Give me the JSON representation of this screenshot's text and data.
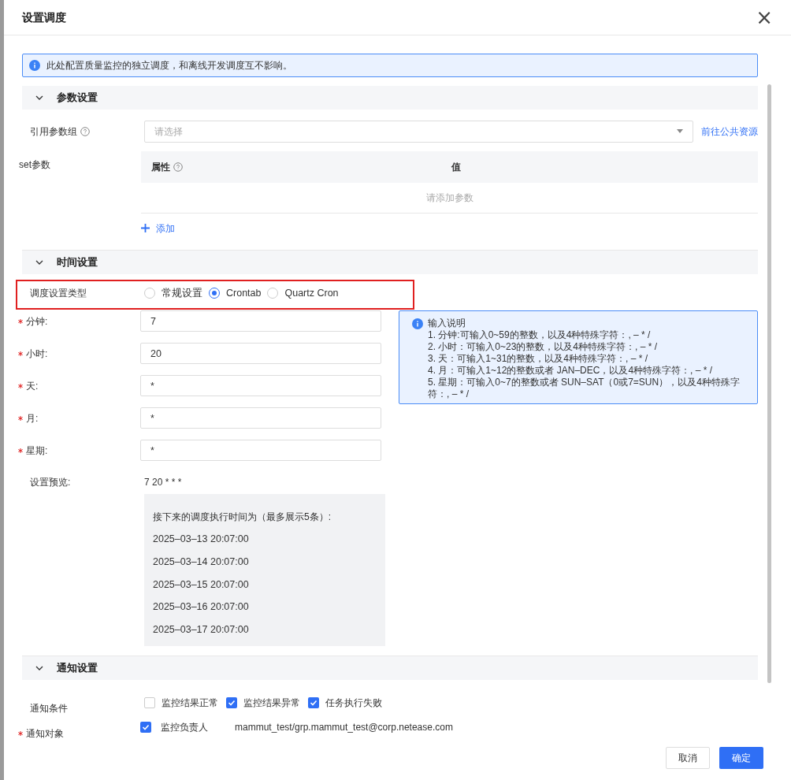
{
  "dialog": {
    "title": "设置调度",
    "close": "×"
  },
  "alert": {
    "text": "此处配置质量监控的独立调度，和离线开发调度互不影响。"
  },
  "param_section": {
    "title": "参数设置",
    "expanded": true,
    "param_group": {
      "label": "引用参数组",
      "placeholder": "请选择",
      "link": "前往公共资源"
    },
    "set_params": {
      "label": "set参数",
      "columns": [
        "属性",
        "值"
      ],
      "empty": "请添加参数",
      "add": "添加"
    }
  },
  "time_section": {
    "title": "时间设置",
    "expanded": true,
    "type_row": {
      "label": "调度设置类型",
      "highlighted": true,
      "options": [
        {
          "label": "常规设置",
          "selected": false
        },
        {
          "label": "Crontab",
          "selected": true
        },
        {
          "label": "Quartz Cron",
          "selected": false
        }
      ]
    },
    "fields": [
      {
        "label": "分钟:",
        "required": true,
        "value": "7"
      },
      {
        "label": "小时:",
        "required": true,
        "value": "20"
      },
      {
        "label": "天:",
        "required": true,
        "value": "*"
      },
      {
        "label": "月:",
        "required": true,
        "value": "*"
      },
      {
        "label": "星期:",
        "required": true,
        "value": "*"
      }
    ],
    "help": {
      "title": "输入说明",
      "lines": [
        "1. 分钟:可输入0~59的整数，以及4种特殊字符：, – * /",
        "2. 小时：可输入0~23的整数，以及4种特殊字符：, – * /",
        "3. 天：可输入1~31的整数，以及4种特殊字符：, – * /",
        "4. 月：可输入1~12的整数或者 JAN–DEC，以及4种特殊字符：, – * /",
        "5. 星期：可输入0~7的整数或者 SUN–SAT（0或7=SUN），以及4种特殊字符：, – * /"
      ]
    },
    "preview": {
      "label": "设置预览:",
      "expression": "7 20 * * *",
      "heading": "接下来的调度执行时间为（最多展示5条）:",
      "times": [
        "2025–03–13 20:07:00",
        "2025–03–14 20:07:00",
        "2025–03–15 20:07:00",
        "2025–03–16 20:07:00",
        "2025–03–17 20:07:00"
      ]
    }
  },
  "notify_section": {
    "title": "通知设置",
    "expanded": true,
    "conditions": {
      "label": "通知条件",
      "options": [
        {
          "label": "监控结果正常",
          "checked": false
        },
        {
          "label": "监控结果异常",
          "checked": true
        },
        {
          "label": "任务执行失败",
          "checked": true
        }
      ]
    },
    "targets": {
      "label": "通知对象",
      "required": true,
      "options": [
        {
          "label": "监控负责人",
          "checked": true
        }
      ],
      "value": "mammut_test/grp.mammut_test@corp.netease.com"
    }
  },
  "buttons": [
    {
      "label": "取消",
      "kind": "secondary"
    },
    {
      "label": "确定",
      "kind": "primary"
    }
  ]
}
